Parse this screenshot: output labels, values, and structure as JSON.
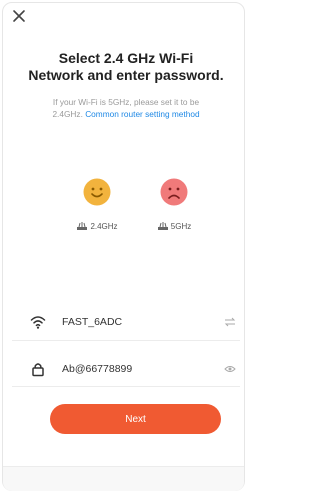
{
  "header": {
    "title_line1": "Select 2.4 GHz Wi-Fi",
    "title_line2": "Network and enter password.",
    "subtitle_line1": "If your Wi-Fi is 5GHz, please set it to be",
    "subtitle_line2_prefix": "2.4GHz.",
    "subtitle_link": "Common router setting method"
  },
  "bands": [
    {
      "label": "2.4GHz",
      "status": "supported",
      "color": "#f2b33d"
    },
    {
      "label": "5GHz",
      "status": "not-supported",
      "color": "#f07a7a"
    }
  ],
  "network": {
    "ssid": "FAST_6ADC",
    "password": "Ab@66778899"
  },
  "actions": {
    "next_label": "Next"
  },
  "colors": {
    "accent": "#f05a32",
    "link": "#1e88e5"
  }
}
